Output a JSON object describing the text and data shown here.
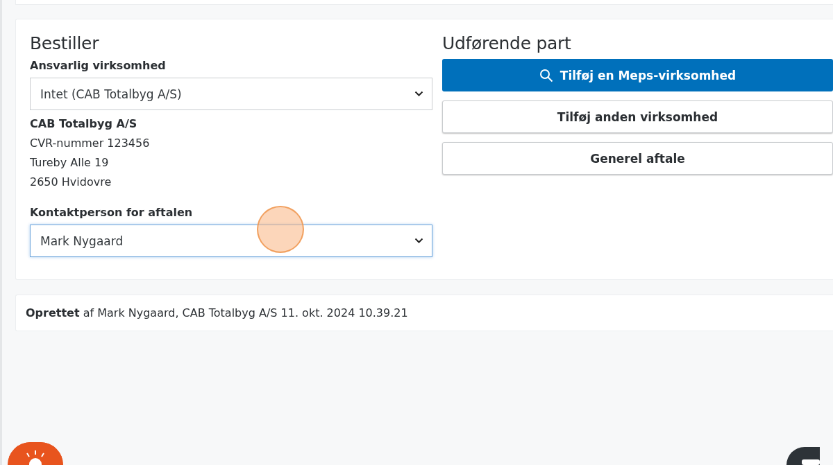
{
  "orderer": {
    "heading": "Bestiller",
    "company_field": {
      "label": "Ansvarlig virksomhed",
      "value": "Intet (CAB Totalbyg A/S)",
      "focused": false
    },
    "company": {
      "name": "CAB Totalbyg A/S",
      "lines": [
        "CVR-nummer 123456",
        "Tureby Alle 19",
        "2650 Hvidovre"
      ]
    },
    "contact_field": {
      "label": "Kontaktperson for aftalen",
      "value": "Mark Nygaard",
      "focused": true
    }
  },
  "contractor": {
    "heading": "Udførende part",
    "buttons": [
      {
        "label": "Tilføj en Meps-virksomhed",
        "kind": "primary"
      },
      {
        "label": "Tilføj anden virksomhed",
        "kind": "secondary"
      },
      {
        "label": "Generel aftale",
        "kind": "secondary"
      }
    ]
  },
  "created": "**Oprettet** af Mark Nygaard, CAB Totalbyg A/S 11. okt. 2024 10.39.21"
}
